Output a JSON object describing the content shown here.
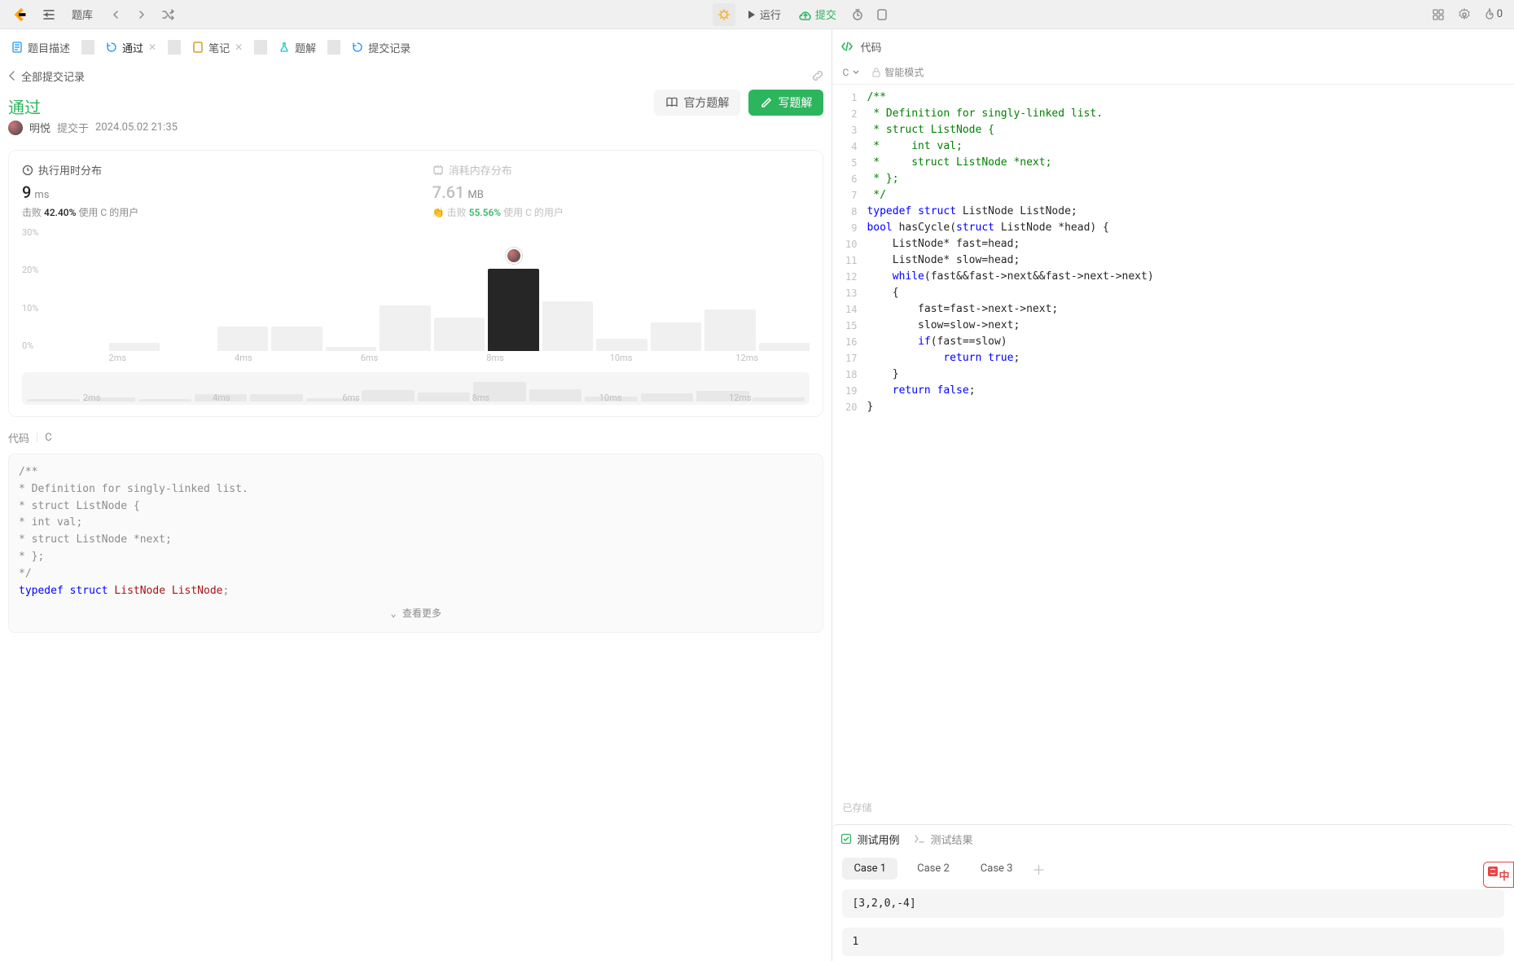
{
  "topbar": {
    "problems_label": "题库",
    "run_label": "运行",
    "submit_label": "提交",
    "streak_count": "0"
  },
  "left": {
    "tabs": {
      "description": "题目描述",
      "passed": "通过",
      "notes": "笔记",
      "solutions": "题解",
      "submissions": "提交记录"
    },
    "back_label": "全部提交记录",
    "status": "通过",
    "author": "明悦",
    "submitted_prefix": "提交于",
    "submitted_at": "2024.05.02 21:35",
    "official_solution_btn": "官方题解",
    "write_solution_btn": "写题解",
    "runtime": {
      "label": "执行用时分布",
      "value": "9",
      "unit": "ms",
      "sub_prefix": "击败",
      "sub_pct": "42.40%",
      "sub_suffix": "使用 C 的用户"
    },
    "memory": {
      "label": "消耗内存分布",
      "value": "7.61",
      "unit": "MB",
      "sub_prefix": "击败",
      "sub_pct": "55.56%",
      "sub_suffix": "使用 C 的用户"
    },
    "code_label": "代码",
    "code_lang": "C",
    "see_more": "查看更多"
  },
  "code_preview": {
    "l1": "/**",
    "l2": " * Definition for singly-linked list.",
    "l3": " * struct ListNode {",
    "l4": " *     int val;",
    "l5": " *     struct ListNode *next;",
    "l6": " * };",
    "l7": " */",
    "l8a": "typedef",
    "l8b": "struct",
    "l8c": "ListNode",
    "l8d": "ListNode",
    "l8e": ";"
  },
  "right": {
    "code_title": "代码",
    "lang": "C",
    "mode_label": "智能模式",
    "saved": "已存储",
    "lines": {
      "1": "/**",
      "2": " * Definition for singly-linked list.",
      "3": " * struct ListNode {",
      "4": " *     int val;",
      "5": " *     struct ListNode *next;",
      "6": " * };",
      "7": " */",
      "8": {
        "a": "typedef",
        "b": "struct",
        "c": " ListNode ListNode;"
      },
      "9": {
        "a": "bool",
        "b": " hasCycle(",
        "c": "struct",
        "d": " ListNode *head) {"
      },
      "10": "    ListNode* fast=head;",
      "11": "    ListNode* slow=head;",
      "12": {
        "a": "    ",
        "b": "while",
        "c": "(fast&&fast->next&&fast->next->next)"
      },
      "13": "    {",
      "14": "        fast=fast->next->next;",
      "15": "        slow=slow->next;",
      "16": {
        "a": "        ",
        "b": "if",
        "c": "(fast==slow)"
      },
      "17": {
        "a": "            ",
        "b": "return",
        "c": " ",
        "d": "true",
        "e": ";"
      },
      "18": "    }",
      "19": {
        "a": "    ",
        "b": "return",
        "c": " ",
        "d": "false",
        "e": ";"
      },
      "20": "}"
    }
  },
  "test": {
    "cases_tab": "测试用例",
    "results_tab": "测试结果",
    "case1": "Case 1",
    "case2": "Case 2",
    "case3": "Case 3",
    "input1": "[3,2,0,-4]",
    "input2": "1"
  },
  "ime": {
    "label": "中"
  },
  "chart_data": {
    "type": "bar",
    "title": "执行用时分布",
    "ylabel": "%",
    "ylim": [
      0,
      30
    ],
    "yticks": [
      "30%",
      "20%",
      "10%",
      "0%"
    ],
    "xlabel": "ms",
    "xticks": [
      "2ms",
      "4ms",
      "6ms",
      "8ms",
      "10ms",
      "12ms"
    ],
    "highlighted_value": 9,
    "values_pct": [
      0,
      2,
      0,
      6,
      6,
      1,
      11,
      8,
      20,
      12,
      3,
      7,
      10,
      2
    ],
    "strip_values_pct": [
      0,
      2,
      0,
      6,
      6,
      1,
      11,
      8,
      20,
      12,
      3,
      7,
      10,
      2
    ]
  }
}
